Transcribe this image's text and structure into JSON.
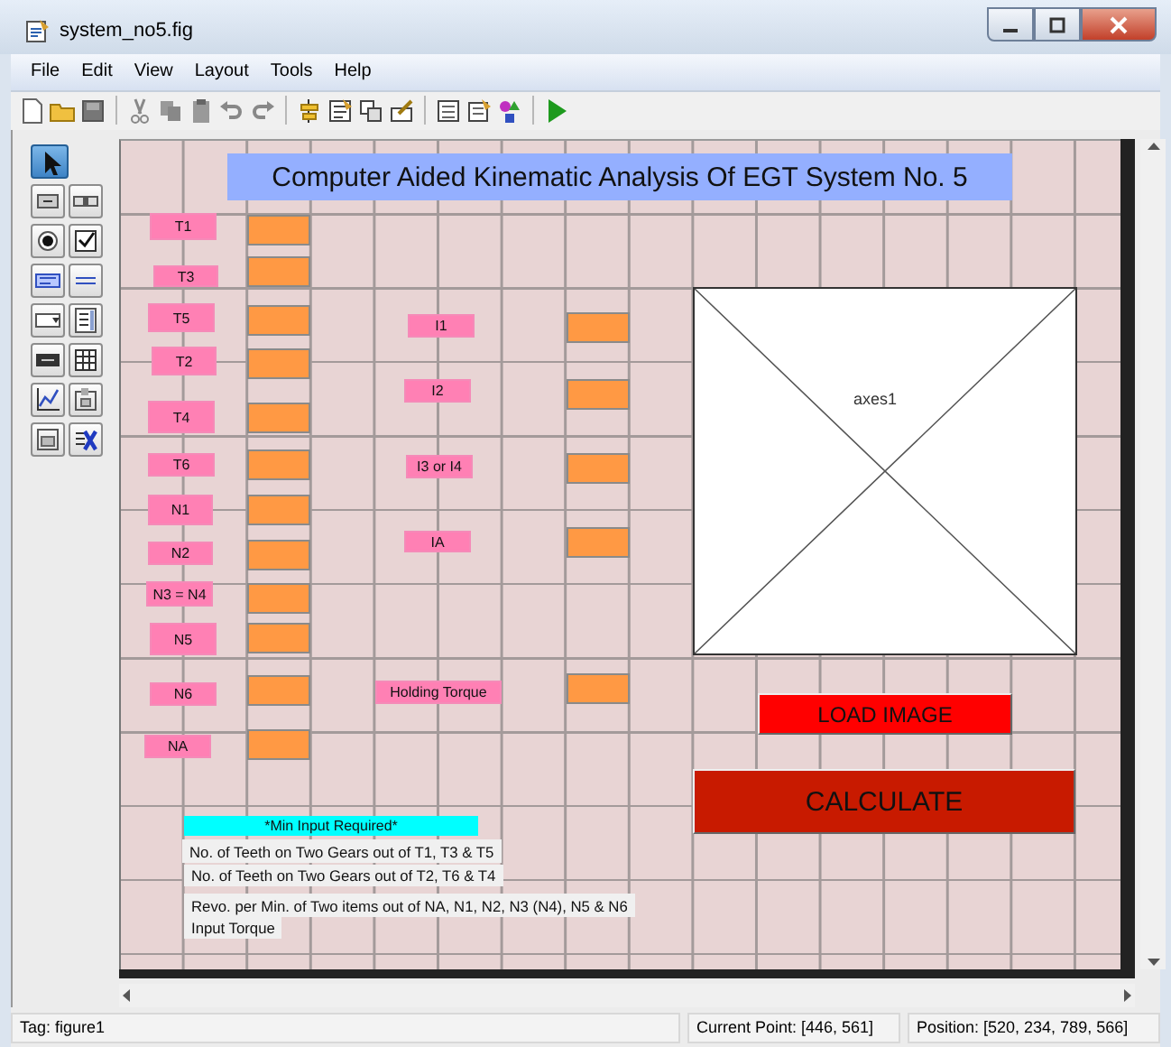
{
  "window": {
    "title": "system_no5.fig"
  },
  "menu": [
    "File",
    "Edit",
    "View",
    "Layout",
    "Tools",
    "Help"
  ],
  "palette": [
    {
      "kind": "pointer",
      "selected": true
    },
    {
      "kind": "push",
      "selected": false
    },
    {
      "kind": "slider",
      "selected": false
    },
    {
      "kind": "radio",
      "selected": false
    },
    {
      "kind": "check",
      "selected": false
    },
    {
      "kind": "edit",
      "selected": false
    },
    {
      "kind": "text",
      "selected": false
    },
    {
      "kind": "popup",
      "selected": false
    },
    {
      "kind": "list",
      "selected": false
    },
    {
      "kind": "toggle",
      "selected": false
    },
    {
      "kind": "table",
      "selected": false
    },
    {
      "kind": "axes",
      "selected": false
    },
    {
      "kind": "panel",
      "selected": false
    },
    {
      "kind": "group",
      "selected": false
    },
    {
      "kind": "activex",
      "selected": false
    }
  ],
  "canvas": {
    "components": [
      {
        "kind": "title",
        "text": "Computer Aided Kinematic Analysis Of EGT System No. 5"
      },
      {
        "kind": "label",
        "text": "T1"
      },
      {
        "kind": "edit"
      },
      {
        "kind": "label",
        "text": "T3"
      },
      {
        "kind": "edit"
      },
      {
        "kind": "label",
        "text": "T5"
      },
      {
        "kind": "edit"
      },
      {
        "kind": "label",
        "text": "T2"
      },
      {
        "kind": "edit"
      },
      {
        "kind": "label",
        "text": "T4"
      },
      {
        "kind": "edit"
      },
      {
        "kind": "label",
        "text": "T6"
      },
      {
        "kind": "edit"
      },
      {
        "kind": "label",
        "text": "N1"
      },
      {
        "kind": "edit"
      },
      {
        "kind": "label",
        "text": "N2"
      },
      {
        "kind": "edit"
      },
      {
        "kind": "label",
        "text": "N3 = N4"
      },
      {
        "kind": "edit"
      },
      {
        "kind": "label",
        "text": "N5"
      },
      {
        "kind": "edit"
      },
      {
        "kind": "label",
        "text": "N6"
      },
      {
        "kind": "edit"
      },
      {
        "kind": "label",
        "text": "NA"
      },
      {
        "kind": "edit"
      },
      {
        "kind": "label",
        "text": "I1"
      },
      {
        "kind": "edit"
      },
      {
        "kind": "label",
        "text": "I2"
      },
      {
        "kind": "edit"
      },
      {
        "kind": "label",
        "text": "I3 or  I4"
      },
      {
        "kind": "edit"
      },
      {
        "kind": "label",
        "text": "IA"
      },
      {
        "kind": "edit"
      },
      {
        "kind": "label",
        "text": "Holding Torque"
      },
      {
        "kind": "edit"
      },
      {
        "kind": "axes",
        "text": "axes1"
      },
      {
        "kind": "button",
        "text": "LOAD IMAGE",
        "color": "#ff0000"
      },
      {
        "kind": "button",
        "text": "CALCULATE",
        "color": "#c81a00"
      },
      {
        "kind": "required",
        "text": "*Min Input Required*"
      },
      {
        "kind": "note",
        "text": "No. of Teeth on Two Gears out of T1, T3 & T5"
      },
      {
        "kind": "note",
        "text": "No. of Teeth on Two Gears out of T2, T6 & T4"
      },
      {
        "kind": "note",
        "text": "Revo. per Min. of Two items out of NA, N1, N2,  N3 (N4), N5 & N6"
      },
      {
        "kind": "note",
        "text": "Input Torque"
      }
    ]
  },
  "status_bar": {
    "tag": "Tag: figure1",
    "current_point": "Current Point:  [446, 561]",
    "position": "Position: [520, 234, 789, 566]"
  }
}
